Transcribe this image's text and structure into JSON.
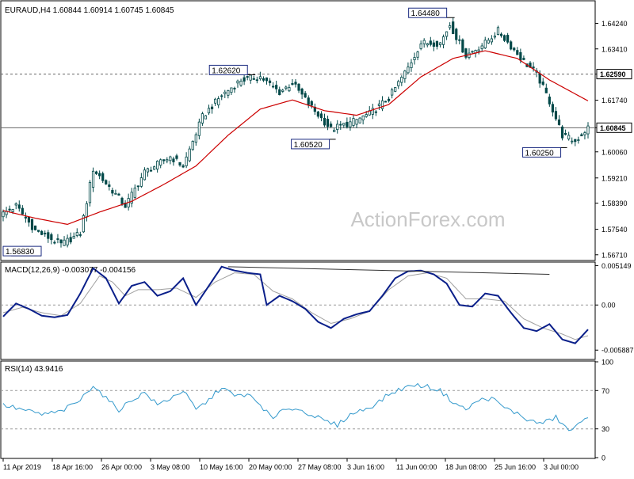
{
  "watermark": "ActionForex.com",
  "colors": {
    "background": "#ffffff",
    "frame": "#000000",
    "candle": "#004848",
    "ma": "#cc0000",
    "macd": "#0a1f8a",
    "signal": "#a0a0a0",
    "rsi": "#3399cc",
    "guide": "#555555",
    "watermark": "#c8c8c8"
  },
  "chart_data": [
    {
      "type": "candlestick",
      "title": "EURAUD,H4  1.60844 1.60914 1.60745 1.60845",
      "ylim": [
        1.5655,
        1.6495
      ],
      "y_ticks": [
        "1.64240",
        "1.63410",
        "1.62590",
        "1.61740",
        "1.60845",
        "1.60060",
        "1.59210",
        "1.58390",
        "1.57540",
        "1.56710"
      ],
      "tick_values": [
        1.6424,
        1.6341,
        1.6259,
        1.6174,
        1.60845,
        1.6006,
        1.5921,
        1.5839,
        1.5754,
        1.5671
      ],
      "price_boxes": [
        {
          "label": "1.62590",
          "value": 1.6259
        },
        {
          "label": "1.60845",
          "value": 1.60845
        }
      ],
      "hlines": [
        {
          "value": 1.6259,
          "style": "dashed"
        },
        {
          "value": 1.60845,
          "style": "solid"
        }
      ],
      "annotations": [
        {
          "label": "1.56830",
          "value": 1.5683,
          "bar": 1
        },
        {
          "label": "1.62620",
          "value": 1.6262,
          "bar": 77
        },
        {
          "label": "1.60520",
          "value": 1.6052,
          "bar": 102
        },
        {
          "label": "1.64480",
          "value": 1.6448,
          "bar": 139
        },
        {
          "label": "1.60250",
          "value": 1.6025,
          "bar": 174
        }
      ],
      "price_path": [
        [
          0,
          1.5805
        ],
        [
          4,
          1.583
        ],
        [
          10,
          1.575
        ],
        [
          18,
          1.5705
        ],
        [
          24,
          1.574
        ],
        [
          28,
          1.595
        ],
        [
          34,
          1.588
        ],
        [
          38,
          1.583
        ],
        [
          44,
          1.594
        ],
        [
          52,
          1.599
        ],
        [
          56,
          1.596
        ],
        [
          62,
          1.612
        ],
        [
          68,
          1.619
        ],
        [
          74,
          1.624
        ],
        [
          80,
          1.625
        ],
        [
          86,
          1.62
        ],
        [
          90,
          1.623
        ],
        [
          96,
          1.615
        ],
        [
          102,
          1.608
        ],
        [
          108,
          1.61
        ],
        [
          114,
          1.613
        ],
        [
          120,
          1.618
        ],
        [
          126,
          1.628
        ],
        [
          130,
          1.636
        ],
        [
          136,
          1.636
        ],
        [
          139,
          1.642
        ],
        [
          144,
          1.632
        ],
        [
          150,
          1.636
        ],
        [
          154,
          1.64
        ],
        [
          158,
          1.635
        ],
        [
          162,
          1.63
        ],
        [
          166,
          1.626
        ],
        [
          170,
          1.617
        ],
        [
          174,
          1.606
        ],
        [
          178,
          1.604
        ],
        [
          182,
          1.6085
        ]
      ],
      "ma_path": [
        [
          0,
          1.5815
        ],
        [
          10,
          1.579
        ],
        [
          20,
          1.577
        ],
        [
          30,
          1.581
        ],
        [
          40,
          1.5845
        ],
        [
          50,
          1.59
        ],
        [
          60,
          1.596
        ],
        [
          70,
          1.606
        ],
        [
          80,
          1.6145
        ],
        [
          90,
          1.6175
        ],
        [
          100,
          1.614
        ],
        [
          110,
          1.6125
        ],
        [
          120,
          1.616
        ],
        [
          130,
          1.625
        ],
        [
          140,
          1.631
        ],
        [
          150,
          1.6335
        ],
        [
          160,
          1.631
        ],
        [
          170,
          1.624
        ],
        [
          182,
          1.6172
        ]
      ],
      "ma_label": ""
    },
    {
      "type": "line",
      "title": "MACD(12,26,9) -0.003077 -0.004156",
      "ylim": [
        -0.007,
        0.0055
      ],
      "y_ticks": [
        "0.005149",
        "0.00",
        "-0.005887"
      ],
      "tick_values": [
        0.005149,
        0.0,
        -0.005887
      ],
      "series": [
        {
          "role": "macd",
          "points": [
            [
              0,
              -0.0015
            ],
            [
              4,
              0.0002
            ],
            [
              8,
              -0.0005
            ],
            [
              12,
              -0.0014
            ],
            [
              16,
              -0.0016
            ],
            [
              20,
              -0.0013
            ],
            [
              24,
              0.0015
            ],
            [
              28,
              0.0048
            ],
            [
              32,
              0.0035
            ],
            [
              36,
              0.0002
            ],
            [
              40,
              0.0025
            ],
            [
              44,
              0.003
            ],
            [
              48,
              0.0012
            ],
            [
              52,
              0.0018
            ],
            [
              56,
              0.0035
            ],
            [
              60,
              0.0
            ],
            [
              64,
              0.0025
            ],
            [
              68,
              0.005
            ],
            [
              72,
              0.0045
            ],
            [
              76,
              0.0042
            ],
            [
              80,
              0.004
            ],
            [
              82,
              0.0
            ],
            [
              86,
              0.0012
            ],
            [
              90,
              0.0005
            ],
            [
              94,
              -0.0005
            ],
            [
              98,
              -0.0022
            ],
            [
              102,
              -0.003
            ],
            [
              106,
              -0.0018
            ],
            [
              110,
              -0.0012
            ],
            [
              114,
              -0.0008
            ],
            [
              118,
              0.0012
            ],
            [
              122,
              0.0035
            ],
            [
              126,
              0.0044
            ],
            [
              130,
              0.0045
            ],
            [
              134,
              0.004
            ],
            [
              138,
              0.0028
            ],
            [
              142,
              0.0
            ],
            [
              146,
              -0.0002
            ],
            [
              150,
              0.0015
            ],
            [
              154,
              0.0012
            ],
            [
              158,
              -0.001
            ],
            [
              162,
              -0.003
            ],
            [
              166,
              -0.0034
            ],
            [
              170,
              -0.0025
            ],
            [
              174,
              -0.0045
            ],
            [
              178,
              -0.005
            ],
            [
              182,
              -0.0032
            ]
          ]
        },
        {
          "role": "signal",
          "points": [
            [
              0,
              -0.001
            ],
            [
              6,
              -0.0003
            ],
            [
              12,
              -0.001
            ],
            [
              18,
              -0.0014
            ],
            [
              24,
              0.0002
            ],
            [
              30,
              0.0038
            ],
            [
              34,
              0.003
            ],
            [
              38,
              0.0012
            ],
            [
              42,
              0.002
            ],
            [
              48,
              0.002
            ],
            [
              54,
              0.0022
            ],
            [
              60,
              0.001
            ],
            [
              66,
              0.003
            ],
            [
              72,
              0.0042
            ],
            [
              78,
              0.004
            ],
            [
              84,
              0.0018
            ],
            [
              90,
              0.0008
            ],
            [
              96,
              -0.001
            ],
            [
              102,
              -0.0024
            ],
            [
              108,
              -0.0018
            ],
            [
              114,
              -0.0008
            ],
            [
              120,
              0.002
            ],
            [
              126,
              0.0038
            ],
            [
              132,
              0.0042
            ],
            [
              138,
              0.0035
            ],
            [
              144,
              0.0008
            ],
            [
              150,
              0.0008
            ],
            [
              156,
              0.0005
            ],
            [
              162,
              -0.0018
            ],
            [
              168,
              -0.003
            ],
            [
              174,
              -0.0038
            ],
            [
              178,
              -0.0045
            ],
            [
              182,
              -0.004
            ]
          ]
        }
      ],
      "trendline": [
        [
          70,
          0.005
        ],
        [
          170,
          0.004
        ]
      ]
    },
    {
      "type": "line",
      "title": "RSI(14) 43.9416",
      "ylim": [
        0,
        100
      ],
      "y_ticks": [
        "100",
        "70",
        "30",
        "0"
      ],
      "tick_values": [
        100,
        70,
        30,
        0
      ],
      "levels": [
        70,
        30
      ],
      "series": [
        {
          "role": "rsi",
          "points": [
            [
              0,
              55
            ],
            [
              6,
              50
            ],
            [
              12,
              45
            ],
            [
              18,
              48
            ],
            [
              24,
              60
            ],
            [
              28,
              76
            ],
            [
              32,
              62
            ],
            [
              36,
              50
            ],
            [
              40,
              60
            ],
            [
              44,
              68
            ],
            [
              48,
              55
            ],
            [
              52,
              62
            ],
            [
              56,
              70
            ],
            [
              60,
              50
            ],
            [
              64,
              60
            ],
            [
              68,
              74
            ],
            [
              72,
              64
            ],
            [
              76,
              66
            ],
            [
              80,
              55
            ],
            [
              84,
              40
            ],
            [
              88,
              52
            ],
            [
              92,
              50
            ],
            [
              96,
              45
            ],
            [
              100,
              38
            ],
            [
              104,
              34
            ],
            [
              108,
              45
            ],
            [
              112,
              50
            ],
            [
              116,
              56
            ],
            [
              120,
              66
            ],
            [
              124,
              72
            ],
            [
              128,
              76
            ],
            [
              132,
              74
            ],
            [
              136,
              70
            ],
            [
              140,
              58
            ],
            [
              144,
              50
            ],
            [
              148,
              60
            ],
            [
              152,
              62
            ],
            [
              156,
              52
            ],
            [
              160,
              46
            ],
            [
              164,
              38
            ],
            [
              168,
              36
            ],
            [
              172,
              42
            ],
            [
              176,
              28
            ],
            [
              180,
              36
            ],
            [
              182,
              44
            ]
          ]
        }
      ]
    }
  ],
  "x_axis": {
    "bar_count": 183,
    "labels": [
      {
        "text": "11 Apr 2019",
        "bar": 0
      },
      {
        "text": "18 Apr 16:00",
        "bar": 22
      },
      {
        "text": "26 Apr 00:00",
        "bar": 44
      },
      {
        "text": "3 May 08:00",
        "bar": 66
      },
      {
        "text": "10 May 16:00",
        "bar": 88
      },
      {
        "text": "20 May 00:00",
        "bar": 110
      },
      {
        "text": "27 May 08:00",
        "bar": 132
      },
      {
        "text": "3 Jun 16:00",
        "bar": 154
      },
      {
        "text": "11 Jun 00:00",
        "bar": 176
      },
      {
        "text": "18 Jun 08:00",
        "bar": 198
      },
      {
        "text": "25 Jun 16:00",
        "bar": 220
      },
      {
        "text": "3 Jul 00:00",
        "bar": 242
      }
    ]
  }
}
